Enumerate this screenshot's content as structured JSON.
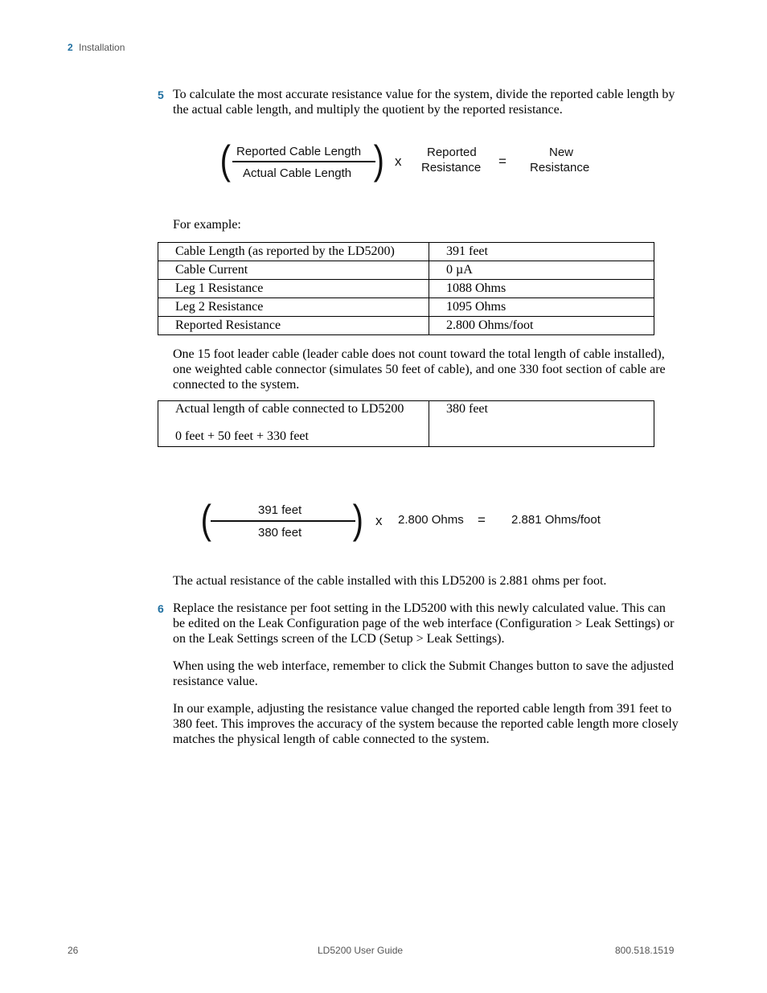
{
  "header": {
    "chapter_number": "2",
    "chapter_title": "Installation"
  },
  "step5": {
    "number": "5",
    "text": "To calculate the most accurate resistance value for the system, divide the reported cable length by the actual cable length, and multiply the quotient by the reported resistance."
  },
  "formula1": {
    "numerator": "Reported Cable Length",
    "denominator": "Actual Cable Length",
    "multiply": "x",
    "multiplier_line1": "Reported",
    "multiplier_line2": "Resistance",
    "equals": "=",
    "result_line1": "New",
    "result_line2": "Resistance"
  },
  "example_label": "For example:",
  "table1": {
    "rows": [
      {
        "label": "Cable Length (as reported by the LD5200)",
        "value": "391 feet"
      },
      {
        "label": "Cable Current",
        "value": "0 µA"
      },
      {
        "label": "Leg 1 Resistance",
        "value": "1088 Ohms"
      },
      {
        "label": "Leg 2 Resistance",
        "value": "1095 Ohms"
      },
      {
        "label": "Reported Resistance",
        "value": "2.800 Ohms/foot"
      }
    ]
  },
  "cable_description": "One 15 foot leader cable (leader cable does not count toward the total length of cable installed), one weighted cable connector (simulates 50 feet of cable), and one 330 foot section of cable are connected to the system.",
  "table2": {
    "label_line1": "Actual length of cable connected to LD5200",
    "label_line2": "0 feet + 50 feet + 330 feet",
    "value": "380 feet"
  },
  "formula2": {
    "numerator": "391 feet",
    "denominator": "380 feet",
    "multiply": "x",
    "multiplier": "2.800 Ohms",
    "equals": "=",
    "result": "2.881 Ohms/foot"
  },
  "result_text": "The actual resistance of the cable installed with this LD5200 is 2.881 ohms per foot.",
  "step6": {
    "number": "6",
    "text": "Replace the resistance per foot setting in the LD5200 with this newly calculated value. This can be edited on the Leak Configuration page of the web interface (Configuration > Leak Settings) or on the Leak Settings screen of the LCD (Setup > Leak Settings)."
  },
  "web_note": "When using the web interface, remember to click the Submit Changes button to save the adjusted resistance value.",
  "conclusion": "In our example, adjusting the resistance value changed the reported cable length from 391 feet to 380 feet. This improves the accuracy of the system because the reported cable length more closely matches the physical length of cable connected to the system.",
  "footer": {
    "page_number": "26",
    "guide_title": "LD5200 User Guide",
    "phone": "800.518.1519"
  },
  "colors": {
    "accent": "#1f6fa0"
  }
}
